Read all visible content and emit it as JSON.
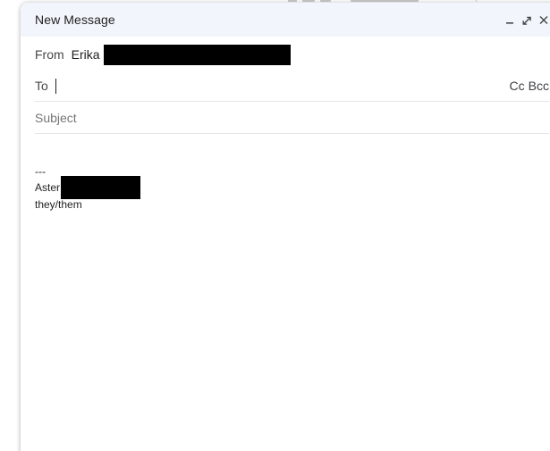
{
  "window": {
    "title": "New Message",
    "controls": [
      {
        "name": "minimize",
        "icon": "minimize-icon"
      },
      {
        "name": "expand",
        "icon": "expand-icon"
      },
      {
        "name": "close",
        "icon": "close-icon"
      }
    ]
  },
  "fields": {
    "from_label": "From",
    "from_name": "Erika",
    "to_label": "To",
    "to_value": "",
    "cc_label": "Cc",
    "bcc_label": "Bcc",
    "subject_placeholder": "Subject",
    "subject_value": ""
  },
  "body": {
    "separator": "---",
    "signature_name": "Aster",
    "signature_pronouns": "they/them"
  },
  "colors": {
    "header_bg": "#f2f6fc",
    "text": "#1f1f1f",
    "muted": "#757575",
    "divider": "#e6e6e6",
    "redaction": "#000000"
  }
}
